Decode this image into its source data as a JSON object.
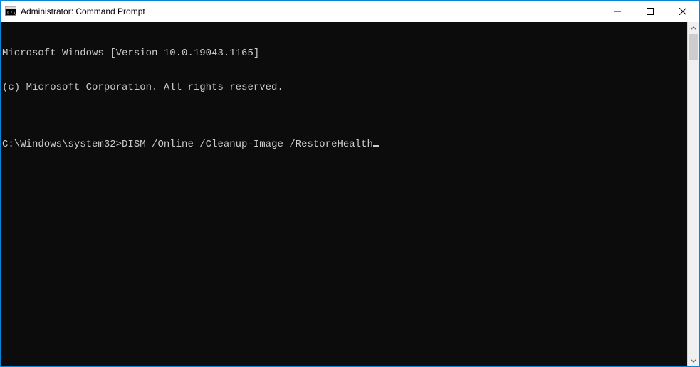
{
  "window": {
    "title": "Administrator: Command Prompt"
  },
  "terminal": {
    "line1": "Microsoft Windows [Version 10.0.19043.1165]",
    "line2": "(c) Microsoft Corporation. All rights reserved.",
    "blank": "",
    "prompt": "C:\\Windows\\system32>",
    "command": "DISM /Online /Cleanup-Image /RestoreHealth"
  }
}
